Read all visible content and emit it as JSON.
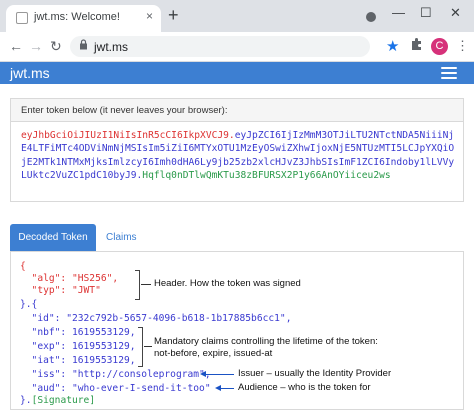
{
  "browser": {
    "tab_title": "jwt.ms: Welcome!",
    "tab_close": "×",
    "new_tab": "+",
    "url": "jwt.ms",
    "avatar_letter": "C",
    "back": "←",
    "forward": "→",
    "reload": "↻",
    "lock": "🔒",
    "star": "★",
    "puzzle": "⬢",
    "menu": "⋮",
    "minimize": "—",
    "maximize": "☐",
    "close": "✕"
  },
  "app": {
    "brand": "jwt.ms"
  },
  "token_panel": {
    "label": "Enter token below (it never leaves your browser):",
    "header_part": "eyJhbGciOiJIUzI1NiIsInR5cCI6IkpXVCJ9.",
    "payload_part": "eyJpZCI6IjIzMmM3OTJiLTU2NTctNDA5NiiiNjE4LTFiMTc4ODViNmNjMSIsIm5iZiI6MTYxOTU1MzEyOSwiZXhwIjoxNjE5NTUzMTI5LCJpYXQiOjE2MTk1NTMxMjksImlzcyI6Imh0dHA6Ly9jb25zb2xlcHJvZ3JhbSIsImF1ZCI6Indoby1lLVVyLUktc2VuZC1pdC10byJ9.",
    "signature_part": "Hqflq0nDTlwQmKTu38zBFURSX2P1y66AnOYiiceu2ws"
  },
  "tabs": {
    "decoded": "Decoded Token",
    "claims": "Claims"
  },
  "decoded": {
    "lines": {
      "l1": "{",
      "l2_key": "  \"alg\": ",
      "l2_val": "\"HS256\"",
      "l2_end": ",",
      "l3_key": "  \"typ\": ",
      "l3_val": "\"JWT\"",
      "l4": "}.{",
      "l5": "  \"id\": \"232c792b-5657-4096-b618-1b17885b6cc1\",",
      "l6": "  \"nbf\": 1619553129,",
      "l7": "  \"exp\": 1619553129,",
      "l8": "  \"iat\": 1619553129,",
      "l9": "  \"iss\": \"http://consoleprogram\",",
      "l10": "  \"aud\": \"who-ever-I-send-it-too\"",
      "l11": "}.",
      "l11_sig": "[Signature]"
    },
    "annotations": {
      "header": "Header. How the token was signed",
      "mandatory_1": "Mandatory claims controlling the lifetime of the token:",
      "mandatory_2": "not-before, expire, issued-at",
      "issuer": "Issuer – usually the Identity Provider",
      "audience": "Audience – who is the token for"
    }
  },
  "colors": {
    "navbar": "#3d7fd2",
    "header_red": "#d33",
    "payload_blue": "#3a3ad0",
    "signature_green": "#2a9a4a"
  }
}
